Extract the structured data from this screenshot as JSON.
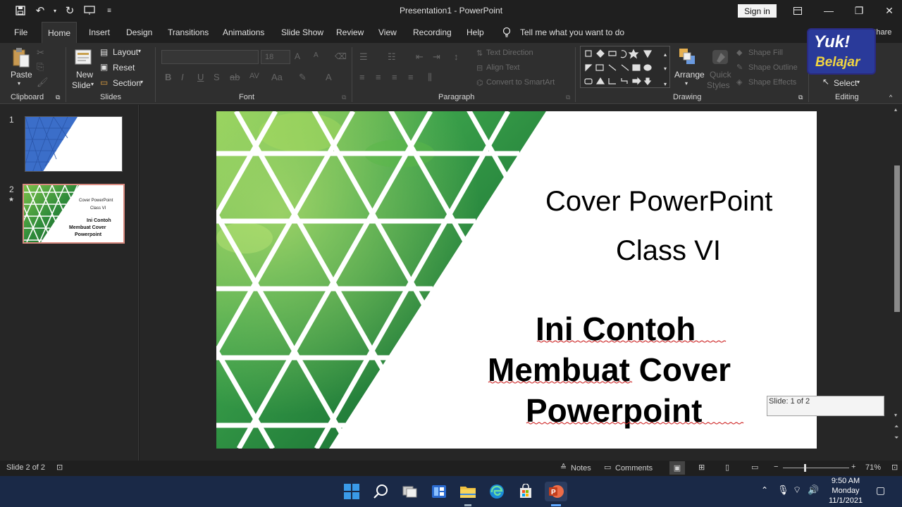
{
  "window": {
    "title": "Presentation1  -  PowerPoint",
    "sign_in": "Sign in"
  },
  "menu": {
    "tabs": [
      "File",
      "Home",
      "Insert",
      "Design",
      "Transitions",
      "Animations",
      "Slide Show",
      "Review",
      "View",
      "Recording",
      "Help"
    ],
    "active_tab": "Home",
    "tell_me": "Tell me what you want to do",
    "share": "Share"
  },
  "ribbon": {
    "clipboard": {
      "label": "Clipboard",
      "paste": "Paste"
    },
    "slides": {
      "label": "Slides",
      "new_slide_1": "New",
      "new_slide_2": "Slide",
      "layout": "Layout",
      "reset": "Reset",
      "section": "Section"
    },
    "font": {
      "label": "Font",
      "size": "18"
    },
    "paragraph": {
      "label": "Paragraph",
      "text_direction": "Text Direction",
      "align_text": "Align Text",
      "convert_smartart": "Convert to SmartArt"
    },
    "drawing": {
      "label": "Drawing",
      "arrange": "Arrange",
      "quick_styles_1": "Quick",
      "quick_styles_2": "Styles",
      "shape_fill": "Shape Fill",
      "shape_outline": "Shape Outline",
      "shape_effects": "Shape Effects"
    },
    "editing": {
      "label": "Editing",
      "select": "Select"
    }
  },
  "thumbnails": [
    {
      "number": "1"
    },
    {
      "number": "2",
      "star": "★",
      "line1": "Cover PowerPoint",
      "line2": "Class VI",
      "line3": "Ini Contoh",
      "line4": "Membuat Cover",
      "line5": "Powerpoint"
    }
  ],
  "slide": {
    "line1": "Cover PowerPoint",
    "line2": "Class VI",
    "bold1": "Ini Contoh",
    "bold2": "Membuat Cover",
    "bold3": "Powerpoint"
  },
  "tooltip": "Slide: 1 of 2",
  "status": {
    "slide_of": "Slide 2 of 2",
    "notes": "Notes",
    "comments": "Comments",
    "zoom": "71%"
  },
  "taskbar": {
    "time": "9:50 AM",
    "day": "Monday",
    "date": "11/1/2021"
  },
  "watermark": {
    "line1": "Yuk!",
    "line2": "Belajar"
  },
  "colors": {
    "accent": "#c43e1c",
    "green": "#2e8b3a",
    "blue_slide": "#3b6ec9"
  }
}
